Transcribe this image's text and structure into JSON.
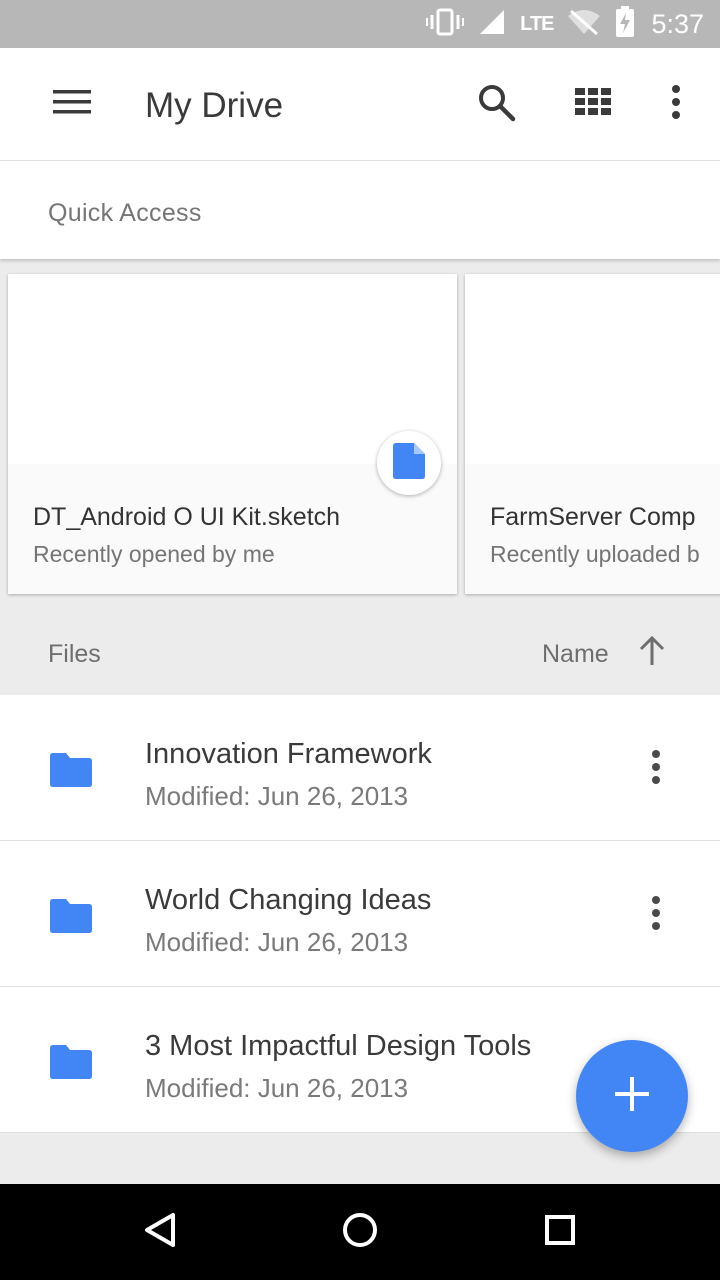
{
  "status_bar": {
    "network": "LTE",
    "time": "5:37",
    "icons": [
      "vibrate-icon",
      "signal-icon",
      "wifi-off-icon",
      "battery-charging-icon"
    ]
  },
  "app_bar": {
    "title": "My Drive",
    "icons": [
      "menu-icon",
      "search-icon",
      "grid-view-icon",
      "more-vert-icon"
    ]
  },
  "quick_access": {
    "label": "Quick Access",
    "cards": [
      {
        "title": "DT_Android O UI Kit.sketch",
        "subtitle": "Recently opened by me",
        "icon": "doc-icon"
      },
      {
        "title": "FarmServer Comp",
        "subtitle": "Recently uploaded b"
      }
    ]
  },
  "files_header": {
    "label": "Files",
    "sort_label": "Name",
    "sort_icon": "arrow-up-icon"
  },
  "files": [
    {
      "name": "Innovation Framework",
      "meta": "Modified: Jun 26, 2013"
    },
    {
      "name": "World Changing Ideas",
      "meta": "Modified: Jun 26, 2013"
    },
    {
      "name": "3 Most Impactful Design Tools",
      "meta": "Modified: Jun 26, 2013"
    }
  ],
  "fab": {
    "icon": "add-icon"
  },
  "nav_bar": {
    "icons": [
      "back-icon",
      "home-icon",
      "recents-icon"
    ]
  },
  "colors": {
    "accent": "#4285f4",
    "status_bar": "#b7b7b7",
    "background": "#ececec"
  }
}
